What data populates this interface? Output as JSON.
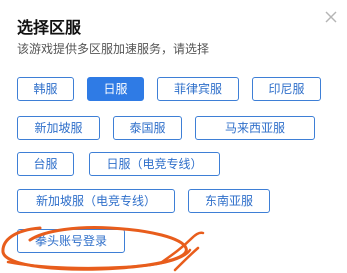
{
  "dialog": {
    "title": "选择区服",
    "subtitle": "该游戏提供多区服加速服务，请选择",
    "close_icon": "close-icon"
  },
  "servers": [
    {
      "label": "韩服",
      "selected": false
    },
    {
      "label": "日服",
      "selected": true
    },
    {
      "label": "菲律宾服",
      "selected": false
    },
    {
      "label": "印尼服",
      "selected": false
    },
    {
      "label": "新加坡服",
      "selected": false
    },
    {
      "label": "泰国服",
      "selected": false
    },
    {
      "label": "马来西亚服",
      "selected": false
    },
    {
      "label": "台服",
      "selected": false
    },
    {
      "label": "日服（电竞专线）",
      "selected": false
    },
    {
      "label": "新加坡服（电竞专线）",
      "selected": false
    },
    {
      "label": "东南亚服",
      "selected": false
    }
  ],
  "login": {
    "label": "拳头账号登录"
  },
  "colors": {
    "accent": "#2f7be5",
    "border": "#3e7fd6",
    "annotation": "#e85d1c"
  }
}
